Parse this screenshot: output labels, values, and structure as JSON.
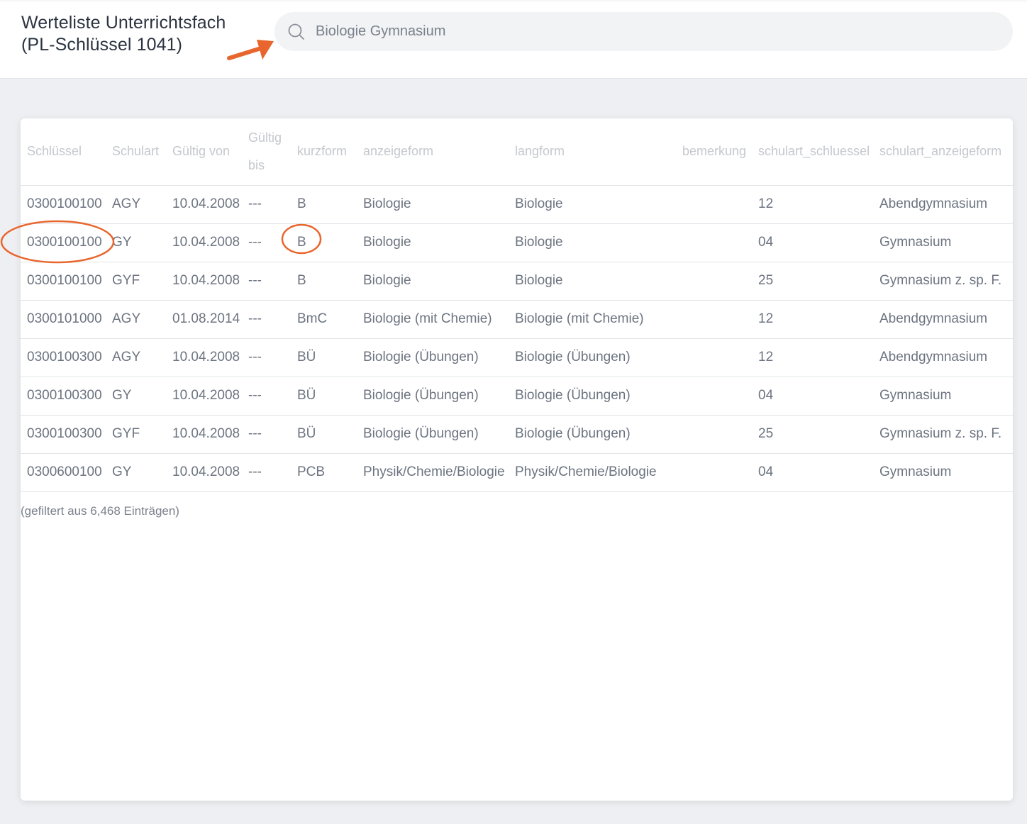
{
  "page": {
    "title_line1": "Werteliste Unterrichtsfach",
    "title_line2": "(PL-Schlüssel 1041)"
  },
  "search": {
    "value": "Biologie Gymnasium",
    "icon": "search-icon"
  },
  "table": {
    "columns": [
      "Schlüssel",
      "Schulart",
      "Gültig von",
      "Gültig bis",
      "kurzform",
      "anzeigeform",
      "langform",
      "bemerkung",
      "schulart_schluessel",
      "schulart_anzeigeform"
    ],
    "rows": [
      [
        "0300100100",
        "AGY",
        "10.04.2008",
        "---",
        "B",
        "Biologie",
        "Biologie",
        "",
        "12",
        "Abendgymnasium"
      ],
      [
        "0300100100",
        "GY",
        "10.04.2008",
        "---",
        "B",
        "Biologie",
        "Biologie",
        "",
        "04",
        "Gymnasium"
      ],
      [
        "0300100100",
        "GYF",
        "10.04.2008",
        "---",
        "B",
        "Biologie",
        "Biologie",
        "",
        "25",
        "Gymnasium z. sp. F."
      ],
      [
        "0300101000",
        "AGY",
        "01.08.2014",
        "---",
        "BmC",
        "Biologie (mit Chemie)",
        "Biologie (mit Chemie)",
        "",
        "12",
        "Abendgymnasium"
      ],
      [
        "0300100300",
        "AGY",
        "10.04.2008",
        "---",
        "BÜ",
        "Biologie (Übungen)",
        "Biologie (Übungen)",
        "",
        "12",
        "Abendgymnasium"
      ],
      [
        "0300100300",
        "GY",
        "10.04.2008",
        "---",
        "BÜ",
        "Biologie (Übungen)",
        "Biologie (Übungen)",
        "",
        "04",
        "Gymnasium"
      ],
      [
        "0300100300",
        "GYF",
        "10.04.2008",
        "---",
        "BÜ",
        "Biologie (Übungen)",
        "Biologie (Übungen)",
        "",
        "25",
        "Gymnasium z. sp. F."
      ],
      [
        "0300600100",
        "GY",
        "10.04.2008",
        "---",
        "PCB",
        "Physik/Chemie/Biologie",
        "Physik/Chemie/Biologie",
        "",
        "04",
        "Gymnasium"
      ]
    ],
    "footer": "(gefiltert aus 6,468 Einträgen)"
  },
  "annotations": {
    "color": "#e8662e"
  }
}
